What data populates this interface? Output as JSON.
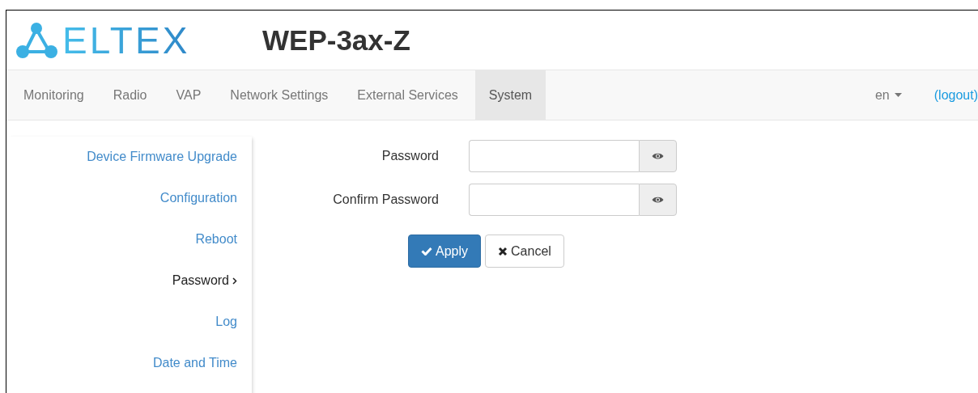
{
  "header": {
    "logo": "ELTEX",
    "title": "WEP-3ax-Z"
  },
  "tabs": [
    {
      "label": "Monitoring",
      "selected": false
    },
    {
      "label": "Radio",
      "selected": false
    },
    {
      "label": "VAP",
      "selected": false
    },
    {
      "label": "Network Settings",
      "selected": false
    },
    {
      "label": "External Services",
      "selected": false
    },
    {
      "label": "System",
      "selected": true
    }
  ],
  "language": "en",
  "logout": "(logout)",
  "sidebar": {
    "items": [
      {
        "label": "Device Firmware Upgrade",
        "selected": false
      },
      {
        "label": "Configuration",
        "selected": false
      },
      {
        "label": "Reboot",
        "selected": false
      },
      {
        "label": "Password",
        "selected": true
      },
      {
        "label": "Log",
        "selected": false
      },
      {
        "label": "Date and Time",
        "selected": false
      }
    ]
  },
  "form": {
    "fields": [
      {
        "label": "Password"
      },
      {
        "label": "Confirm Password"
      }
    ],
    "buttons": [
      {
        "kind": "apply",
        "label": "Apply"
      },
      {
        "kind": "cancel",
        "label": "Cancel"
      }
    ]
  }
}
